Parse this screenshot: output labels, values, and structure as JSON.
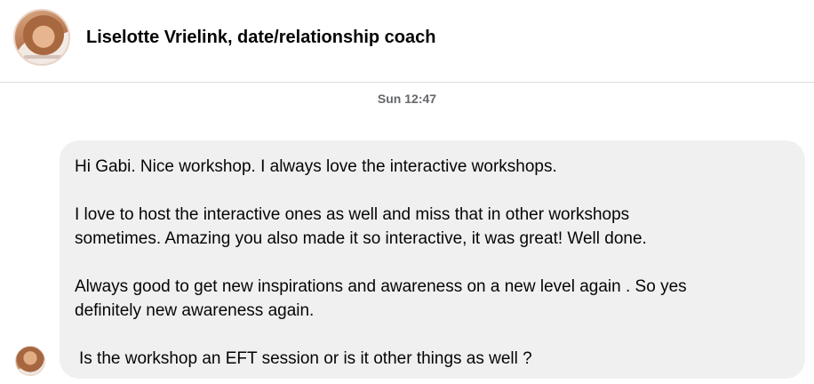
{
  "header": {
    "contact_name": "Liselotte Vrielink, date/relationship coach",
    "avatar_icon": "profile-photo-icon"
  },
  "conversation": {
    "timestamp": "Sun 12:47",
    "message": {
      "paragraphs": [
        "Hi Gabi. Nice workshop. I always love the interactive workshops.",
        "I love to host the interactive ones as well and miss that in other workshops\nsometimes. Amazing you also made it so interactive, it was great! Well done.",
        "Always good to get new inspirations and awareness on a new level again . So yes\ndefinitely new awareness again.",
        "Is the workshop an EFT session or is it other things as well ?"
      ],
      "bubble_color": "#f0f0f0"
    },
    "sender_avatar_icon": "sender-photo-icon"
  }
}
